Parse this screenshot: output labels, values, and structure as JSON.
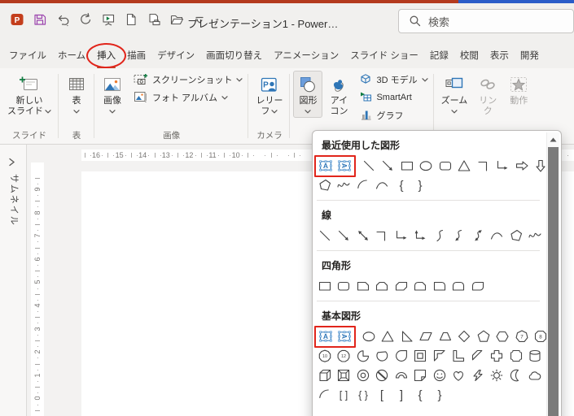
{
  "chrome": {
    "title": "プレゼンテーション1 - Power…",
    "search_placeholder": "検索",
    "qat_icons": [
      "powerpoint-logo",
      "save",
      "undo",
      "redo",
      "start-slideshow",
      "new-file",
      "print-preview",
      "open-folder",
      "qat-more"
    ]
  },
  "tabs": [
    {
      "label": "ファイル"
    },
    {
      "label": "ホーム"
    },
    {
      "label": "挿入",
      "selected": true,
      "annotated": true
    },
    {
      "label": "描画"
    },
    {
      "label": "デザイン"
    },
    {
      "label": "画面切り替え"
    },
    {
      "label": "アニメーション"
    },
    {
      "label": "スライド ショー"
    },
    {
      "label": "記録"
    },
    {
      "label": "校閲"
    },
    {
      "label": "表示"
    },
    {
      "label": "開発"
    }
  ],
  "ribbon": {
    "groups": [
      {
        "label": "スライド",
        "items": [
          {
            "kind": "big",
            "icon": "new-slide",
            "lines": [
              "新しい",
              "スライド"
            ],
            "chevron": true
          }
        ]
      },
      {
        "label": "表",
        "items": [
          {
            "kind": "big",
            "icon": "table",
            "lines": [
              "表"
            ],
            "chevron": true
          }
        ]
      },
      {
        "label": "画像",
        "items": [
          {
            "kind": "big",
            "icon": "picture",
            "lines": [
              "画像"
            ],
            "chevron": true
          },
          {
            "kind": "stack",
            "buttons": [
              {
                "icon": "screenshot",
                "label": "スクリーンショット",
                "chevron": true
              },
              {
                "icon": "photo-album",
                "label": "フォト アルバム",
                "chevron": true
              }
            ]
          }
        ]
      },
      {
        "label": "カメラ",
        "items": [
          {
            "kind": "big",
            "icon": "relief",
            "lines": [
              "レリー",
              "フ"
            ],
            "chevron": true
          }
        ]
      },
      {
        "label": "",
        "items": [
          {
            "kind": "big",
            "icon": "shapes",
            "lines": [
              "図形"
            ],
            "chevron": true,
            "pressed": true
          },
          {
            "kind": "big",
            "icon": "icons",
            "lines": [
              "アイ",
              "コン"
            ]
          },
          {
            "kind": "stack",
            "buttons": [
              {
                "icon": "3d-model",
                "label": "3D モデル",
                "chevron": true
              },
              {
                "icon": "smartart",
                "label": "SmartArt"
              },
              {
                "icon": "chart",
                "label": "グラフ"
              }
            ]
          }
        ]
      },
      {
        "label": "",
        "items": [
          {
            "kind": "big",
            "icon": "zoom",
            "lines": [
              "ズーム"
            ],
            "chevron": true
          },
          {
            "kind": "big",
            "icon": "link",
            "lines": [
              "リン",
              "ク"
            ],
            "disabled": true
          },
          {
            "kind": "big",
            "icon": "action",
            "lines": [
              "動作"
            ],
            "disabled": true
          }
        ]
      }
    ]
  },
  "panes": {
    "thumbnail_label": "サムネイル"
  },
  "rulers": {
    "horizontal_numbers": [
      "16",
      "15",
      "14",
      "13",
      "12",
      "11",
      "10"
    ],
    "vertical_numbers": [
      "9",
      "8",
      "7",
      "6",
      "5",
      "4",
      "3",
      "2",
      "1",
      "0"
    ]
  },
  "shapes_menu": {
    "sections": [
      {
        "title": "最近使用した図形",
        "rows": [
          [
            "textbox-horizontal",
            "textbox-vertical",
            "line",
            "line-arrow",
            "rectangle",
            "oval",
            "rounded-rectangle",
            "isosceles-triangle",
            "elbow-connector",
            "elbow-arrow-connector",
            "arrow-right",
            "arrow-down"
          ],
          [
            "freeform",
            "scribble",
            "arc",
            "curve",
            "brace-left",
            "brace-right"
          ]
        ]
      },
      {
        "title": "線",
        "rows": [
          [
            "line",
            "line-arrow",
            "line-double-arrow",
            "elbow-connector",
            "elbow-arrow-connector",
            "elbow-double-arrow-connector",
            "curved-connector",
            "curved-arrow-connector",
            "curved-double-arrow-connector",
            "curve",
            "freeform",
            "scribble"
          ]
        ]
      },
      {
        "title": "四角形",
        "rows": [
          [
            "rectangle",
            "rounded-rectangle",
            "snip-single-corner",
            "snip-same-side-corners",
            "snip-diagonal-corners",
            "snip-round-single-corner",
            "round-single-corner",
            "round-same-side-corners",
            "round-diagonal-corners"
          ]
        ]
      },
      {
        "title": "基本図形",
        "rows": [
          [
            "textbox-horizontal",
            "textbox-vertical",
            "oval",
            "isosceles-triangle",
            "right-triangle",
            "parallelogram",
            "trapezoid",
            "diamond",
            "pentagon",
            "hexagon",
            "heptagon",
            "octagon"
          ],
          [
            "decagon",
            "dodecagon",
            "pie",
            "chord",
            "teardrop",
            "frame",
            "half-frame",
            "l-shape",
            "diagonal-stripe",
            "cross",
            "plaque",
            "can"
          ],
          [
            "cube",
            "bevel",
            "donut",
            "no-symbol",
            "block-arc",
            "folded-corner",
            "smiley",
            "heart",
            "lightning",
            "sun",
            "moon",
            "cloud"
          ],
          [
            "arc",
            "double-bracket",
            "double-brace",
            "bracket-left",
            "bracket-right",
            "brace-left",
            "brace-right"
          ]
        ]
      }
    ],
    "highlights": [
      {
        "section": 0,
        "row": 0,
        "count": 2
      },
      {
        "section": 3,
        "row": 0,
        "count": 2
      }
    ]
  },
  "annotations": {
    "color": "#e1251b"
  }
}
